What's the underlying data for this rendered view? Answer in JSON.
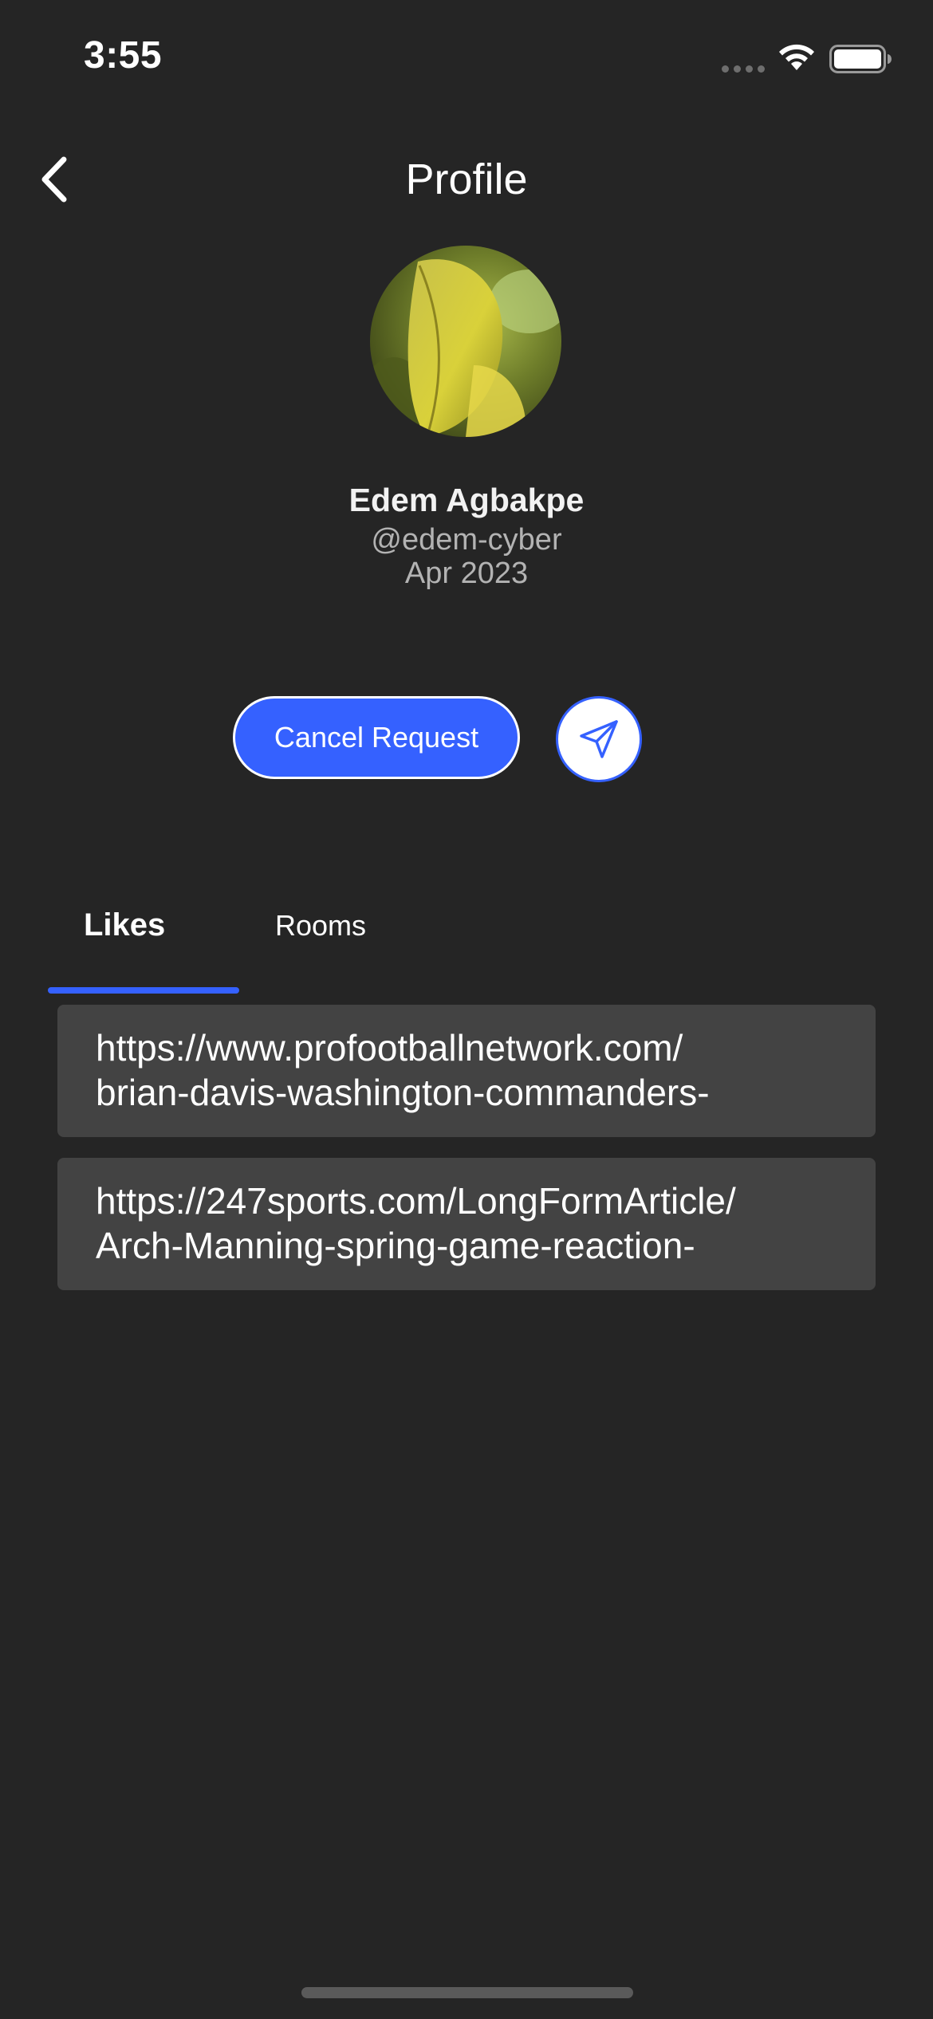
{
  "status_bar": {
    "time": "3:55",
    "icons": [
      "cellular-signal-icon",
      "wifi-icon",
      "battery-icon"
    ]
  },
  "header": {
    "title": "Profile",
    "back_icon": "chevron-left-icon"
  },
  "profile": {
    "name": "Edem Agbakpe",
    "handle": "@edem-cyber",
    "joined": "Apr 2023",
    "avatar": "yellow-leaf-photo"
  },
  "actions": {
    "cancel_request_label": "Cancel Request",
    "send_icon": "paper-plane-icon"
  },
  "tabs": [
    {
      "label": "Likes",
      "active": true
    },
    {
      "label": "Rooms",
      "active": false
    }
  ],
  "likes": [
    {
      "line1": "https://www.profootballnetwork.com/",
      "line2": "brian-davis-washington-commanders-"
    },
    {
      "line1": "https://247sports.com/LongFormArticle/",
      "line2": "Arch-Manning-spring-game-reaction-"
    }
  ],
  "colors": {
    "background": "#252525",
    "accent": "#3561ff",
    "card": "#434343",
    "secondary_text": "#b3b3b3"
  }
}
